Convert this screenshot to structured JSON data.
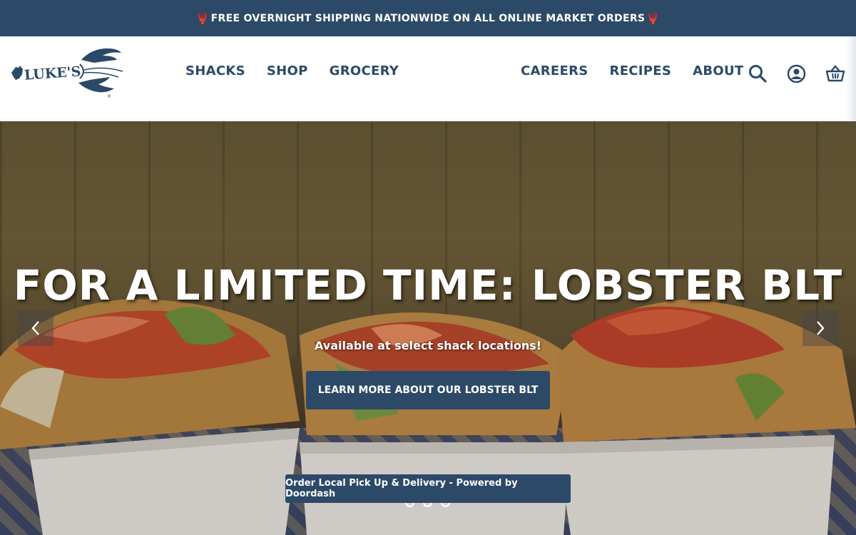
{
  "promo": {
    "text": "FREE OVERNIGHT SHIPPING NATIONWIDE ON ALL ONLINE MARKET ORDERS",
    "icon": "lobster-icon"
  },
  "header": {
    "logo_text": "LUKE'S",
    "nav_left": [
      {
        "label": "SHACKS"
      },
      {
        "label": "SHOP"
      },
      {
        "label": "GROCERY"
      }
    ],
    "nav_right": [
      {
        "label": "CAREERS"
      },
      {
        "label": "RECIPES"
      },
      {
        "label": "ABOUT"
      }
    ],
    "icons": [
      "search-icon",
      "account-icon",
      "basket-icon"
    ]
  },
  "hero": {
    "title": "FOR A LIMITED TIME: LOBSTER BLT",
    "subtitle": "Available at select shack locations!",
    "cta_label": "LEARN MORE ABOUT OUR LOBSTER BLT",
    "order_label": "Order Local Pick Up & Delivery - Powered by Doordash",
    "slide_count": 3,
    "active_slide": 1
  },
  "colors": {
    "brand_navy": "#2c4a67",
    "lobster_red": "#d8342c",
    "white": "#ffffff"
  }
}
